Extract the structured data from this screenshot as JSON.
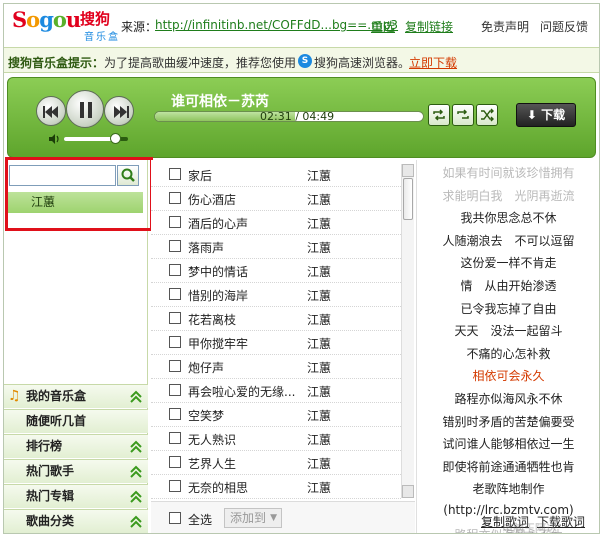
{
  "app": {
    "logo_parts": [
      "S",
      "o",
      "g",
      "o",
      "u"
    ],
    "logo_cn": "搜狗",
    "logo_sub": "音乐盒"
  },
  "top": {
    "source_label": "来源：",
    "source_url": "http://infinitinb.net/COFFdD...bg==.mp3",
    "retry": "重选",
    "copy_link": "复制链接",
    "disclaimer": "免责声明",
    "feedback": "问题反馈"
  },
  "notice": {
    "title": "搜狗音乐盒提示：",
    "text": "为了提高歌曲缓冲速度，推荐您使用",
    "browser": "搜狗高速浏览器。",
    "download": "立即下载"
  },
  "player": {
    "title": "谁可相依－苏芮",
    "time": "02:31 / 04:49",
    "progress": 0.524,
    "volume": 0.8,
    "download": "下载"
  },
  "search": {
    "value": "",
    "result": "江蕙"
  },
  "categories": [
    {
      "label": "我的音乐盒",
      "has_note": true
    },
    {
      "label": "随便听几首",
      "has_note": false
    },
    {
      "label": "排行榜",
      "has_note": false
    },
    {
      "label": "热门歌手",
      "has_note": false
    },
    {
      "label": "热门专辑",
      "has_note": false
    },
    {
      "label": "歌曲分类",
      "has_note": false
    }
  ],
  "songs": [
    {
      "title": "家后",
      "artist": "江蕙"
    },
    {
      "title": "伤心酒店",
      "artist": "江蕙"
    },
    {
      "title": "酒后的心声",
      "artist": "江蕙"
    },
    {
      "title": "落雨声",
      "artist": "江蕙"
    },
    {
      "title": "梦中的情话",
      "artist": "江蕙"
    },
    {
      "title": "惜别的海岸",
      "artist": "江蕙"
    },
    {
      "title": "花若离枝",
      "artist": "江蕙"
    },
    {
      "title": "甲你搅牢牢",
      "artist": "江蕙"
    },
    {
      "title": "炮仔声",
      "artist": "江蕙"
    },
    {
      "title": "再会啦心爱的无缘...",
      "artist": "江蕙"
    },
    {
      "title": "空笑梦",
      "artist": "江蕙"
    },
    {
      "title": "无人熟识",
      "artist": "江蕙"
    },
    {
      "title": "艺界人生",
      "artist": "江蕙"
    },
    {
      "title": "无奈的相思",
      "artist": "江蕙"
    }
  ],
  "list_footer": {
    "select_all": "全选",
    "add_to": "添加到"
  },
  "lyrics": {
    "lines": [
      {
        "text": "如果有时间就该珍惜拥有",
        "state": "dim"
      },
      {
        "text": "求能明白我　光阴再逝流",
        "state": "dim"
      },
      {
        "text": "我共你思念总不休",
        "state": "normal"
      },
      {
        "text": "人随潮浪去　不可以逗留",
        "state": "normal"
      },
      {
        "text": "这份爱一样不肯走",
        "state": "normal"
      },
      {
        "text": "情　从由开始渗透",
        "state": "normal"
      },
      {
        "text": "已令我忘掉了自由",
        "state": "normal"
      },
      {
        "text": "天天　没法一起留斗",
        "state": "normal"
      },
      {
        "text": "不痛的心怎补救",
        "state": "normal"
      },
      {
        "text": "相依可会永久",
        "state": "current"
      },
      {
        "text": "路程亦似海风永不休",
        "state": "normal"
      },
      {
        "text": "错别时矛盾的苦楚偏要受",
        "state": "normal"
      },
      {
        "text": "试问谁人能够相依过一生",
        "state": "normal"
      },
      {
        "text": "即使将前途通通牺牲也肯",
        "state": "normal"
      },
      {
        "text": "老歌阵地制作",
        "state": "normal"
      },
      {
        "text": "(http://lrc.bzmtv.com)",
        "state": "normal"
      },
      {
        "text": "路程亦似海风永不休",
        "state": "dim"
      }
    ],
    "copy": "复制歌词",
    "download": "下载歌词"
  },
  "watermark": "电脑王阿达"
}
